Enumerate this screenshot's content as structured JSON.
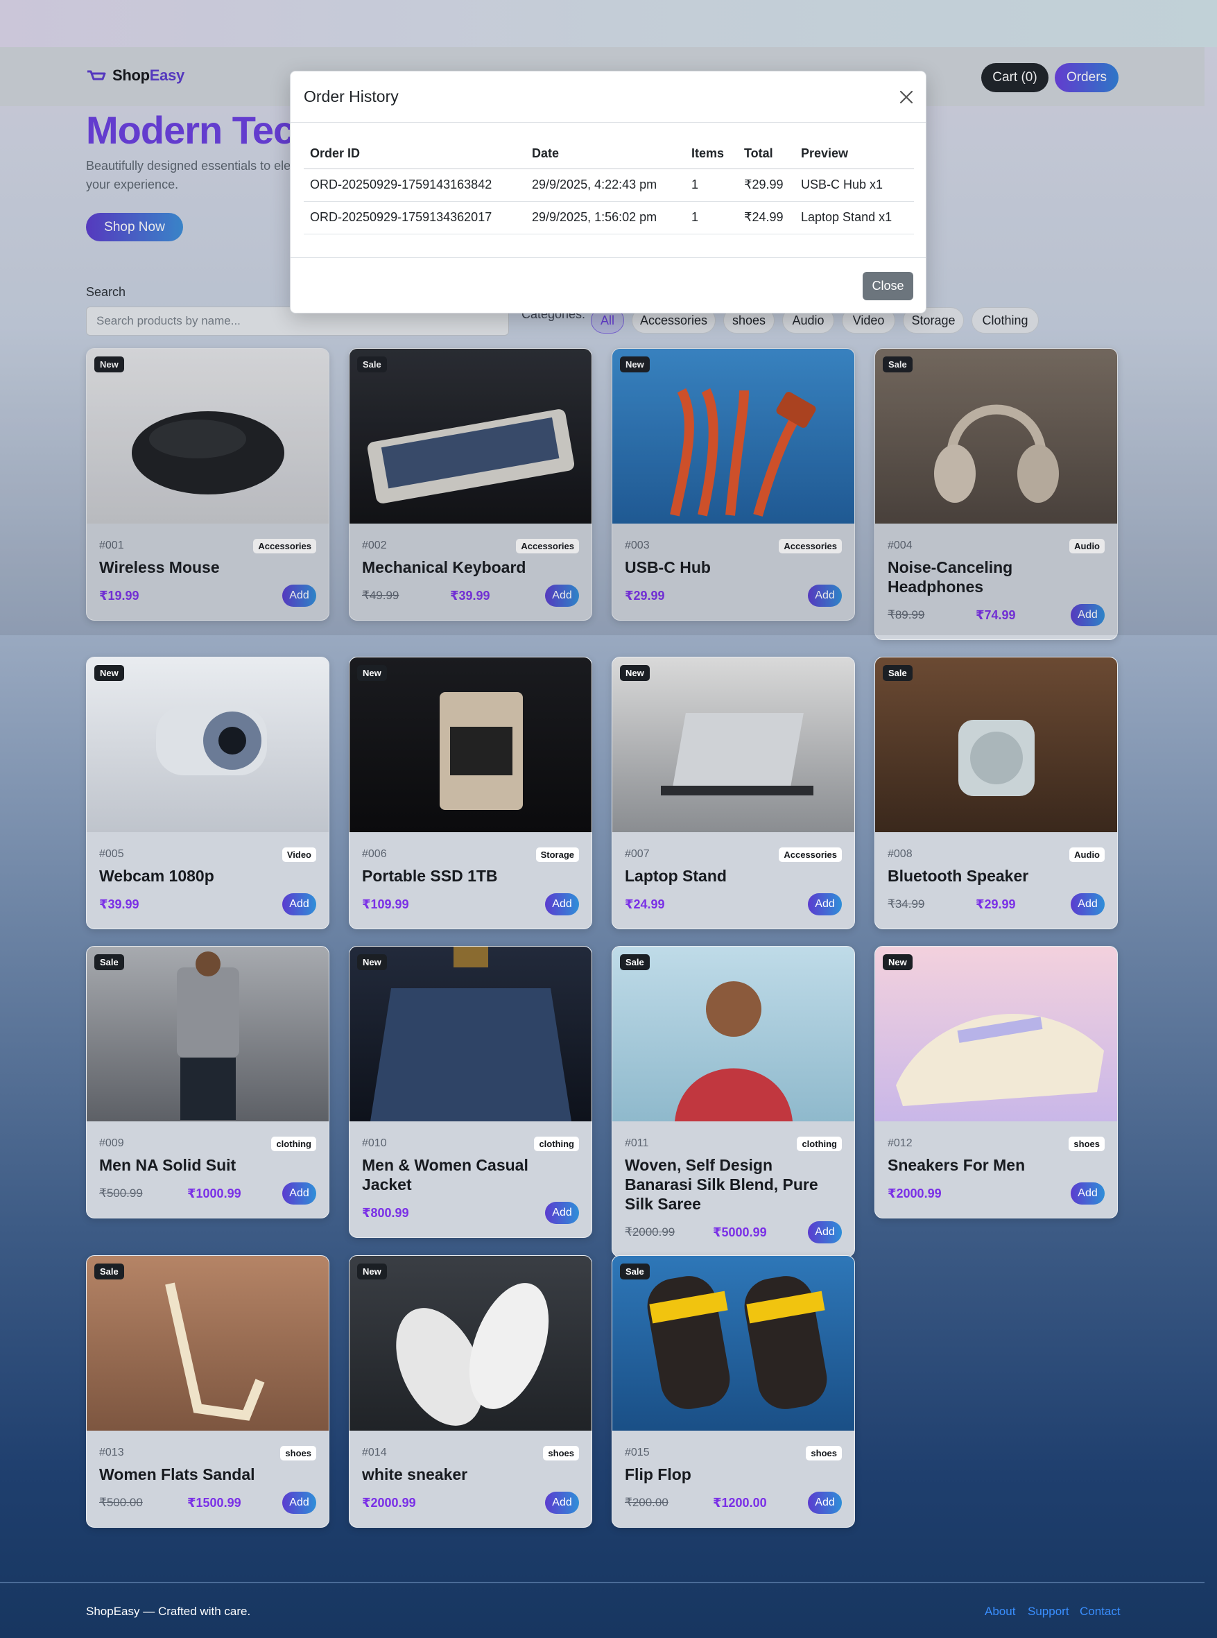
{
  "app": {
    "brand_main": "Shop",
    "brand_accent": "Easy",
    "cart_label": "Cart (0)",
    "orders_label": "Orders"
  },
  "hero": {
    "title": "Modern Tech",
    "subtitle": "Beautifully designed essentials to elevate your experience.",
    "cta": "Shop Now"
  },
  "search": {
    "label": "Search",
    "placeholder": "Search products by name..."
  },
  "categories": {
    "label": "Categories:",
    "items": [
      "All",
      "Accessories",
      "shoes",
      "Audio",
      "Video",
      "Storage",
      "Clothing"
    ],
    "active": "All"
  },
  "add_label": "Add",
  "products": [
    {
      "id": "#001",
      "badge": "New",
      "category": "Accessories",
      "title": "Wireless Mouse",
      "old_price": "",
      "price": "₹19.99"
    },
    {
      "id": "#002",
      "badge": "Sale",
      "category": "Accessories",
      "title": "Mechanical Keyboard",
      "old_price": "₹49.99",
      "price": "₹39.99"
    },
    {
      "id": "#003",
      "badge": "New",
      "category": "Accessories",
      "title": "USB-C Hub",
      "old_price": "",
      "price": "₹29.99"
    },
    {
      "id": "#004",
      "badge": "Sale",
      "category": "Audio",
      "title": "Noise-Canceling Headphones",
      "old_price": "₹89.99",
      "price": "₹74.99"
    },
    {
      "id": "#005",
      "badge": "New",
      "category": "Video",
      "title": "Webcam 1080p",
      "old_price": "",
      "price": "₹39.99"
    },
    {
      "id": "#006",
      "badge": "New",
      "category": "Storage",
      "title": "Portable SSD 1TB",
      "old_price": "",
      "price": "₹109.99"
    },
    {
      "id": "#007",
      "badge": "New",
      "category": "Accessories",
      "title": "Laptop Stand",
      "old_price": "",
      "price": "₹24.99"
    },
    {
      "id": "#008",
      "badge": "Sale",
      "category": "Audio",
      "title": "Bluetooth Speaker",
      "old_price": "₹34.99",
      "price": "₹29.99"
    },
    {
      "id": "#009",
      "badge": "Sale",
      "category": "clothing",
      "title": "Men NA Solid Suit",
      "old_price": "₹500.99",
      "price": "₹1000.99"
    },
    {
      "id": "#010",
      "badge": "New",
      "category": "clothing",
      "title": "Men & Women Casual Jacket",
      "old_price": "",
      "price": "₹800.99"
    },
    {
      "id": "#011",
      "badge": "Sale",
      "category": "clothing",
      "title": "Woven, Self Design Banarasi Silk Blend, Pure Silk Saree",
      "old_price": "₹2000.99",
      "price": "₹5000.99"
    },
    {
      "id": "#012",
      "badge": "New",
      "category": "shoes",
      "title": "Sneakers For Men",
      "old_price": "",
      "price": "₹2000.99"
    },
    {
      "id": "#013",
      "badge": "Sale",
      "category": "shoes",
      "title": "Women Flats Sandal",
      "old_price": "₹500.00",
      "price": "₹1500.99"
    },
    {
      "id": "#014",
      "badge": "New",
      "category": "shoes",
      "title": "white sneaker",
      "old_price": "",
      "price": "₹2000.99"
    },
    {
      "id": "#015",
      "badge": "Sale",
      "category": "shoes",
      "title": "Flip Flop",
      "old_price": "₹200.00",
      "price": "₹1200.00"
    }
  ],
  "modal": {
    "title": "Order History",
    "columns": [
      "Order ID",
      "Date",
      "Items",
      "Total",
      "Preview"
    ],
    "rows": [
      [
        "ORD-20250929-1759143163842",
        "29/9/2025, 4:22:43 pm",
        "1",
        "₹29.99",
        "USB-C Hub x1"
      ],
      [
        "ORD-20250929-1759134362017",
        "29/9/2025, 1:56:02 pm",
        "1",
        "₹24.99",
        "Laptop Stand x1"
      ]
    ],
    "close_label": "Close"
  },
  "footer": {
    "text": "ShopEasy — Crafted with care.",
    "links": [
      "About",
      "Support",
      "Contact"
    ]
  },
  "colors": {
    "accent": "#6a3fe0",
    "price": "#7a30e6",
    "secondary_button": "#6c757d",
    "link": "#3a8fff"
  },
  "icons": {
    "brand": "basket-icon",
    "modal_close": "close-icon"
  }
}
